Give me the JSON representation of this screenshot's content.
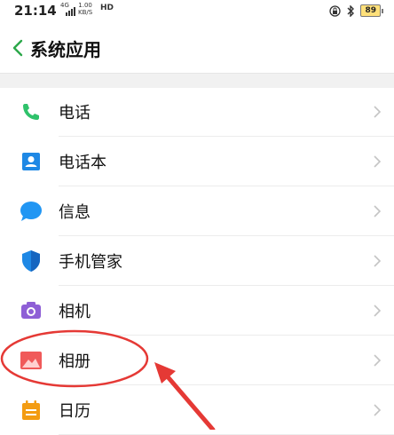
{
  "status_bar": {
    "time": "21:14",
    "network": "4G",
    "speed_value": "1.00",
    "speed_unit": "KB/S",
    "hd": "HD",
    "battery": "89"
  },
  "header": {
    "title": "系统应用"
  },
  "list": {
    "items": [
      {
        "label": "电话",
        "icon": "phone-icon"
      },
      {
        "label": "电话本",
        "icon": "contacts-icon"
      },
      {
        "label": "信息",
        "icon": "message-icon"
      },
      {
        "label": "手机管家",
        "icon": "shield-icon"
      },
      {
        "label": "相机",
        "icon": "camera-icon"
      },
      {
        "label": "相册",
        "icon": "gallery-icon"
      },
      {
        "label": "日历",
        "icon": "calendar-icon"
      }
    ]
  },
  "colors": {
    "phone": "#2fc26b",
    "contacts": "#1e88e5",
    "message": "#2196f3",
    "shield": "#1e88e5",
    "camera": "#8e5fd6",
    "gallery": "#f05a5a",
    "calendar": "#f39c12",
    "annotation": "#e53935"
  }
}
